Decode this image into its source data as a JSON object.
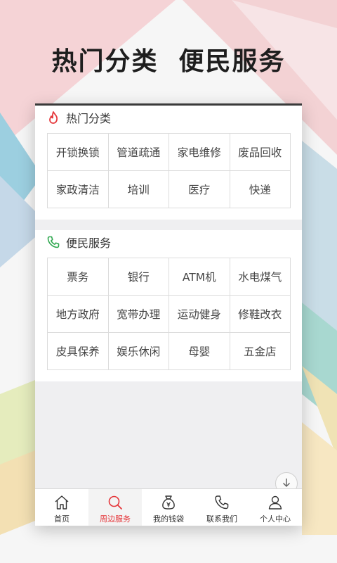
{
  "headline": "热门分类  便民服务",
  "hot": {
    "title": "热门分类",
    "items": [
      "开锁换锁",
      "管道疏通",
      "家电维修",
      "废品回收",
      "家政清洁",
      "培训",
      "医疗",
      "快递"
    ]
  },
  "services": {
    "title": "便民服务",
    "items": [
      "票务",
      "银行",
      "ATM机",
      "水电煤气",
      "地方政府",
      "宽带办理",
      "运动健身",
      "修鞋改衣",
      "皮具保养",
      "娱乐休闲",
      "母婴",
      "五金店"
    ]
  },
  "tabs": [
    {
      "label": "首页",
      "icon": "home-icon"
    },
    {
      "label": "周边服务",
      "icon": "search-icon"
    },
    {
      "label": "我的钱袋",
      "icon": "money-bag-icon"
    },
    {
      "label": "联系我们",
      "icon": "phone-icon"
    },
    {
      "label": "个人中心",
      "icon": "person-icon"
    }
  ],
  "active_tab": "周边服务",
  "colors": {
    "accent": "#e5363a",
    "fire_icon": "#e5363a",
    "phone_icon": "#2fa84f",
    "text": "#333333"
  }
}
